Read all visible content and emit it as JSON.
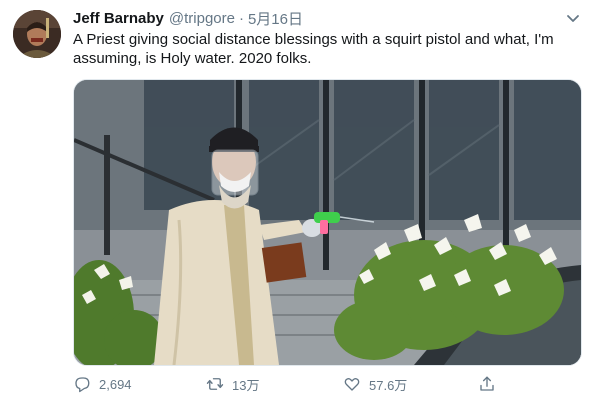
{
  "tweet": {
    "author_name": "Jeff Barnaby",
    "handle": "@tripgore",
    "separator": "·",
    "date": "5月16日",
    "text": "A Priest giving social distance blessings with a squirt pistol and what, I'm assuming, is Holy water. 2020 folks."
  },
  "actions": {
    "reply_count": "2,694",
    "retweet_count": "13万",
    "like_count": "57.6万"
  },
  "icons": {
    "avatar": "user-avatar",
    "caret": "chevron-down-icon",
    "reply": "reply-icon",
    "retweet": "retweet-icon",
    "like": "heart-icon",
    "share": "share-icon"
  },
  "colors": {
    "text_primary": "#14171a",
    "text_secondary": "#657786",
    "border": "#e1e8ed"
  }
}
